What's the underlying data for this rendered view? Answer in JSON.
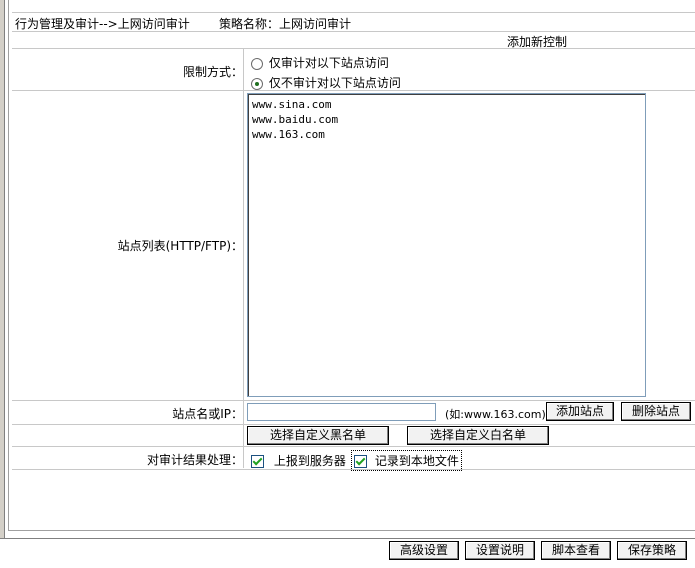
{
  "header": {
    "breadcrumb": "行为管理及审计-->上网访问审计",
    "policy_name": "策略名称：上网访问审计"
  },
  "section_title": "添加新控制",
  "restriction": {
    "label": "限制方式：",
    "options": [
      {
        "label": "仅审计对以下站点访问",
        "selected": false
      },
      {
        "label": "仅不审计对以下站点访问",
        "selected": true
      }
    ]
  },
  "site_list": {
    "label": "站点列表(HTTP/FTP)：",
    "lines": [
      "www.sina.com",
      "www.baidu.com",
      "www.163.com"
    ]
  },
  "site_input": {
    "label": "站点名或IP：",
    "value": "",
    "hint": "(如:www.163.com)",
    "add_button": "添加站点",
    "delete_button": "删除站点"
  },
  "custom_lists": {
    "blacklist_button": "选择自定义黑名单",
    "whitelist_button": "选择自定义白名单"
  },
  "result_handling": {
    "label": "对审计结果处理：",
    "report_server": {
      "label": "上报到服务器",
      "checked": true
    },
    "log_local": {
      "label": "记录到本地文件",
      "checked": true
    }
  },
  "footer_buttons": {
    "advanced": "高级设置",
    "help": "设置说明",
    "script": "脚本查看",
    "save": "保存策略"
  }
}
